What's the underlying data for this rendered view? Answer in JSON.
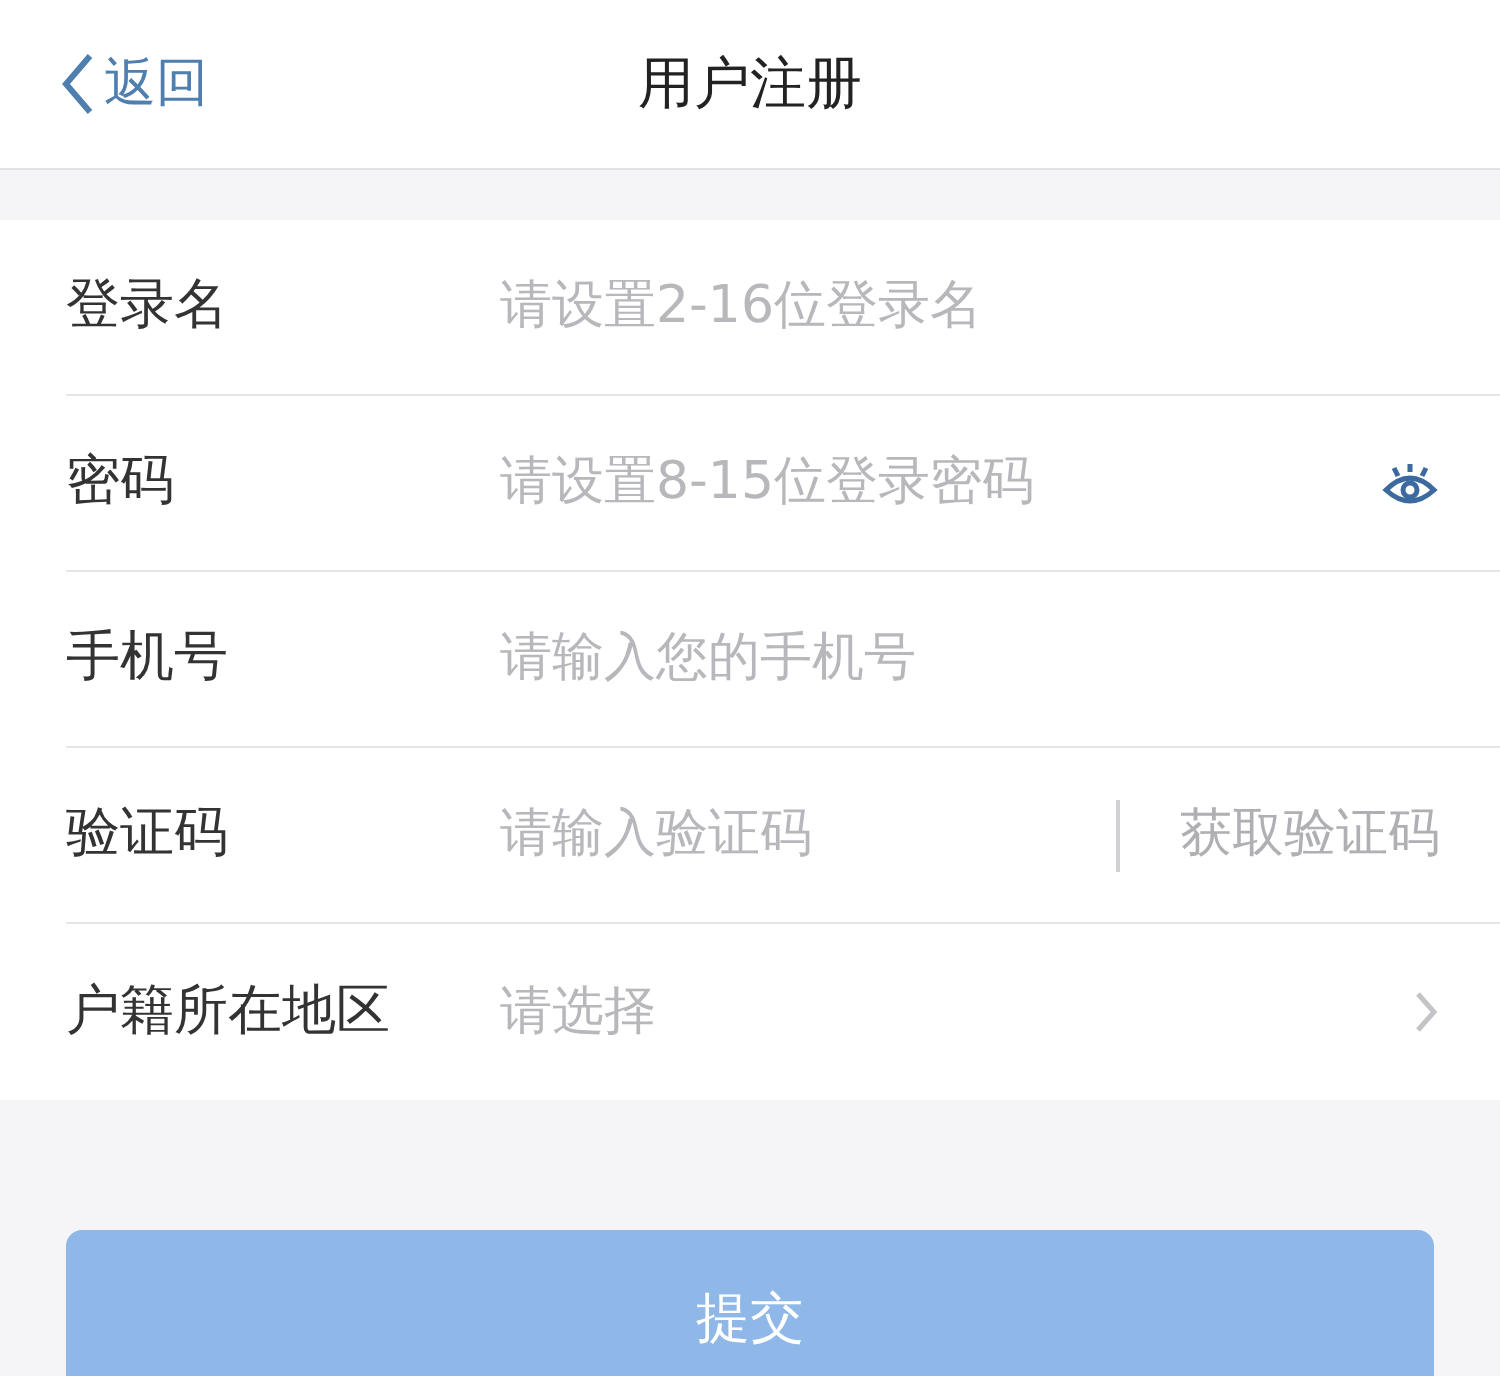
{
  "nav": {
    "back": "返回",
    "title": "用户注册"
  },
  "fields": [
    {
      "kind": "text",
      "label": "登录名",
      "placeholder": "请设置2-16位登录名"
    },
    {
      "kind": "password",
      "label": "密码",
      "placeholder": "请设置8-15位登录密码"
    },
    {
      "kind": "text",
      "label": "手机号",
      "placeholder": "请输入您的手机号"
    },
    {
      "kind": "code",
      "label": "验证码",
      "placeholder": "请输入验证码",
      "action": "获取验证码"
    },
    {
      "kind": "select",
      "label": "户籍所在地区",
      "placeholder": "请选择"
    }
  ],
  "submit": {
    "label": "提交",
    "disabled": true
  }
}
